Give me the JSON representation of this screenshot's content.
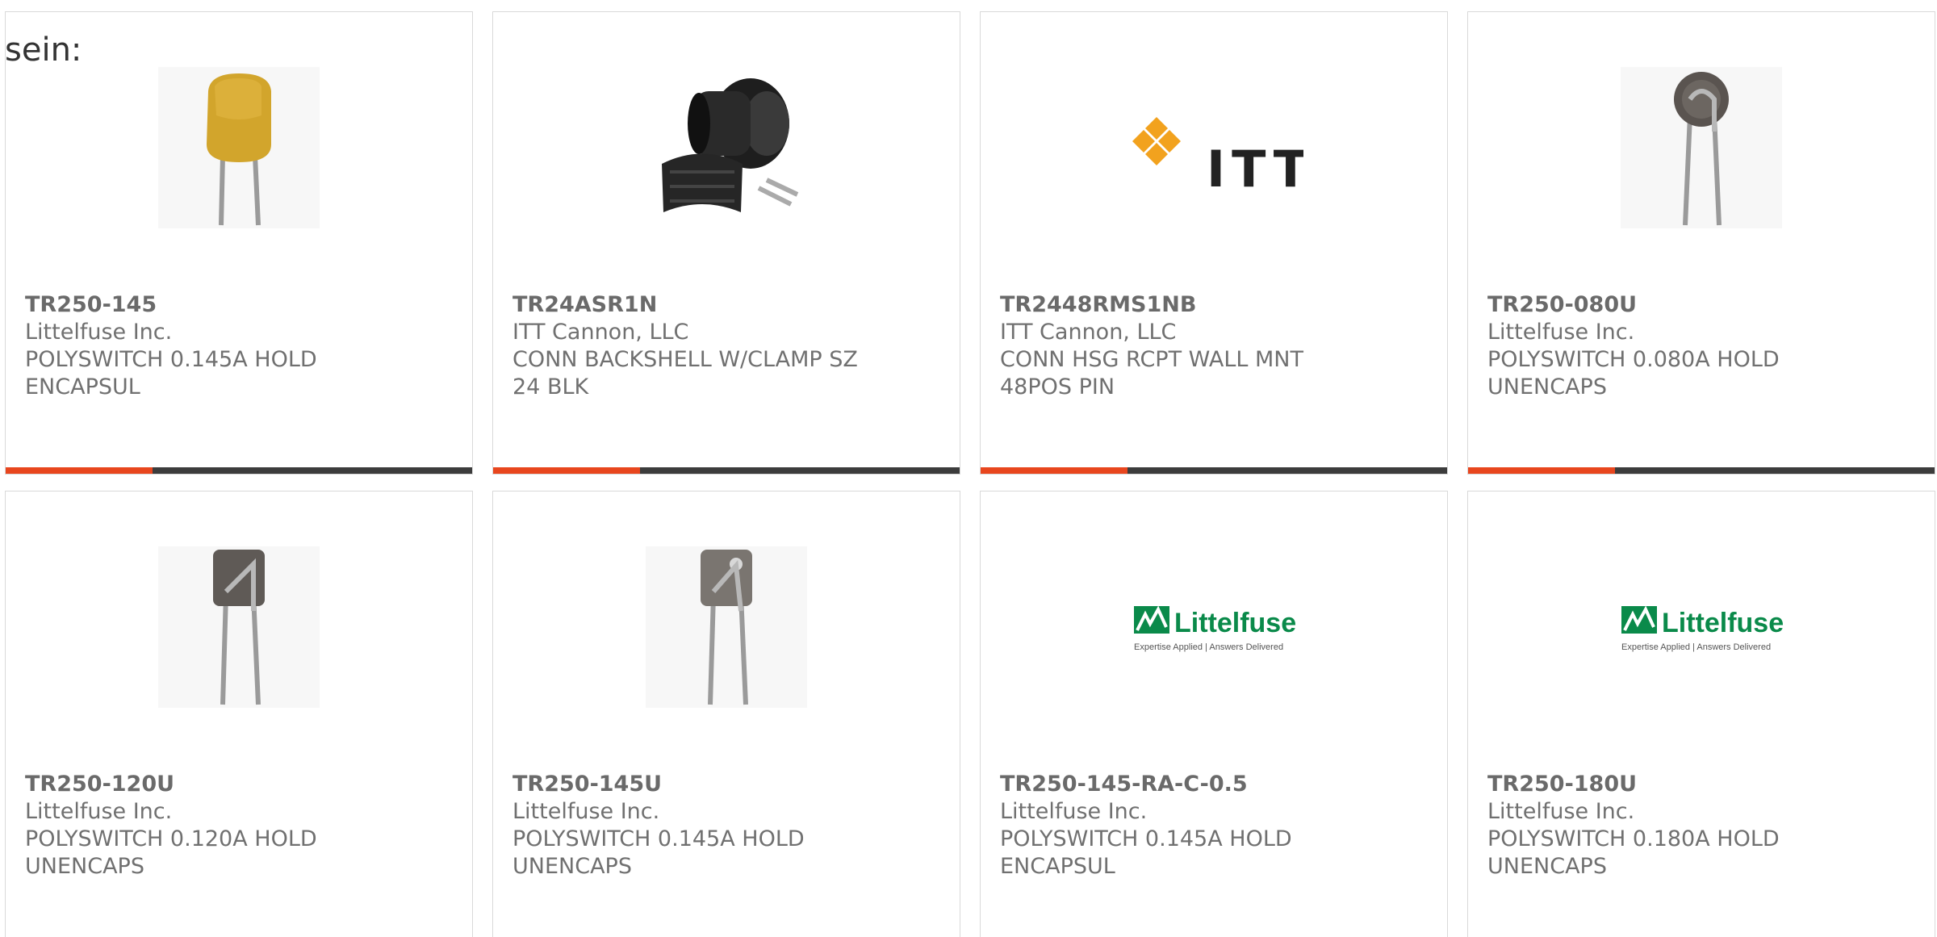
{
  "intro_text": "sein:",
  "colors": {
    "accent": "#e8461e",
    "bar_dark": "#3c3c3c",
    "text": "#707070",
    "littelfuse_green": "#0a8a4a",
    "itt_orange": "#f2a21e"
  },
  "products": [
    {
      "part_number": "TR250-145",
      "manufacturer": "Littelfuse Inc.",
      "desc_line1": "POLYSWITCH 0.145A HOLD",
      "desc_line2": "ENCAPSUL",
      "image": "yellow-ptc-capsule-icon"
    },
    {
      "part_number": "TR24ASR1N",
      "manufacturer": "ITT Cannon, LLC",
      "desc_line1": "CONN BACKSHELL W/CLAMP SZ",
      "desc_line2": "24 BLK",
      "image": "black-backshell-icon"
    },
    {
      "part_number": "TR2448RMS1NB",
      "manufacturer": "ITT Cannon, LLC",
      "desc_line1": "CONN HSG RCPT WALL MNT",
      "desc_line2": "48POS PIN",
      "image": "itt-logo",
      "logo_text": "ITT"
    },
    {
      "part_number": "TR250-080U",
      "manufacturer": "Littelfuse Inc.",
      "desc_line1": "POLYSWITCH 0.080A HOLD",
      "desc_line2": "UNENCAPS",
      "image": "round-disc-ptc-icon"
    },
    {
      "part_number": "TR250-120U",
      "manufacturer": "Littelfuse Inc.",
      "desc_line1": "POLYSWITCH 0.120A HOLD",
      "desc_line2": "UNENCAPS",
      "image": "square-disc-ptc-icon"
    },
    {
      "part_number": "TR250-145U",
      "manufacturer": "Littelfuse Inc.",
      "desc_line1": "POLYSWITCH 0.145A HOLD",
      "desc_line2": "UNENCAPS",
      "image": "square-disc-ptc-icon"
    },
    {
      "part_number": "TR250-145-RA-C-0.5",
      "manufacturer": "Littelfuse Inc.",
      "desc_line1": "POLYSWITCH 0.145A HOLD",
      "desc_line2": "ENCAPSUL",
      "image": "littelfuse-logo",
      "logo_text": "Littelfuse",
      "logo_tagline": "Expertise Applied | Answers Delivered"
    },
    {
      "part_number": "TR250-180U",
      "manufacturer": "Littelfuse Inc.",
      "desc_line1": "POLYSWITCH 0.180A HOLD",
      "desc_line2": "UNENCAPS",
      "image": "littelfuse-logo",
      "logo_text": "Littelfuse",
      "logo_tagline": "Expertise Applied | Answers Delivered"
    }
  ]
}
